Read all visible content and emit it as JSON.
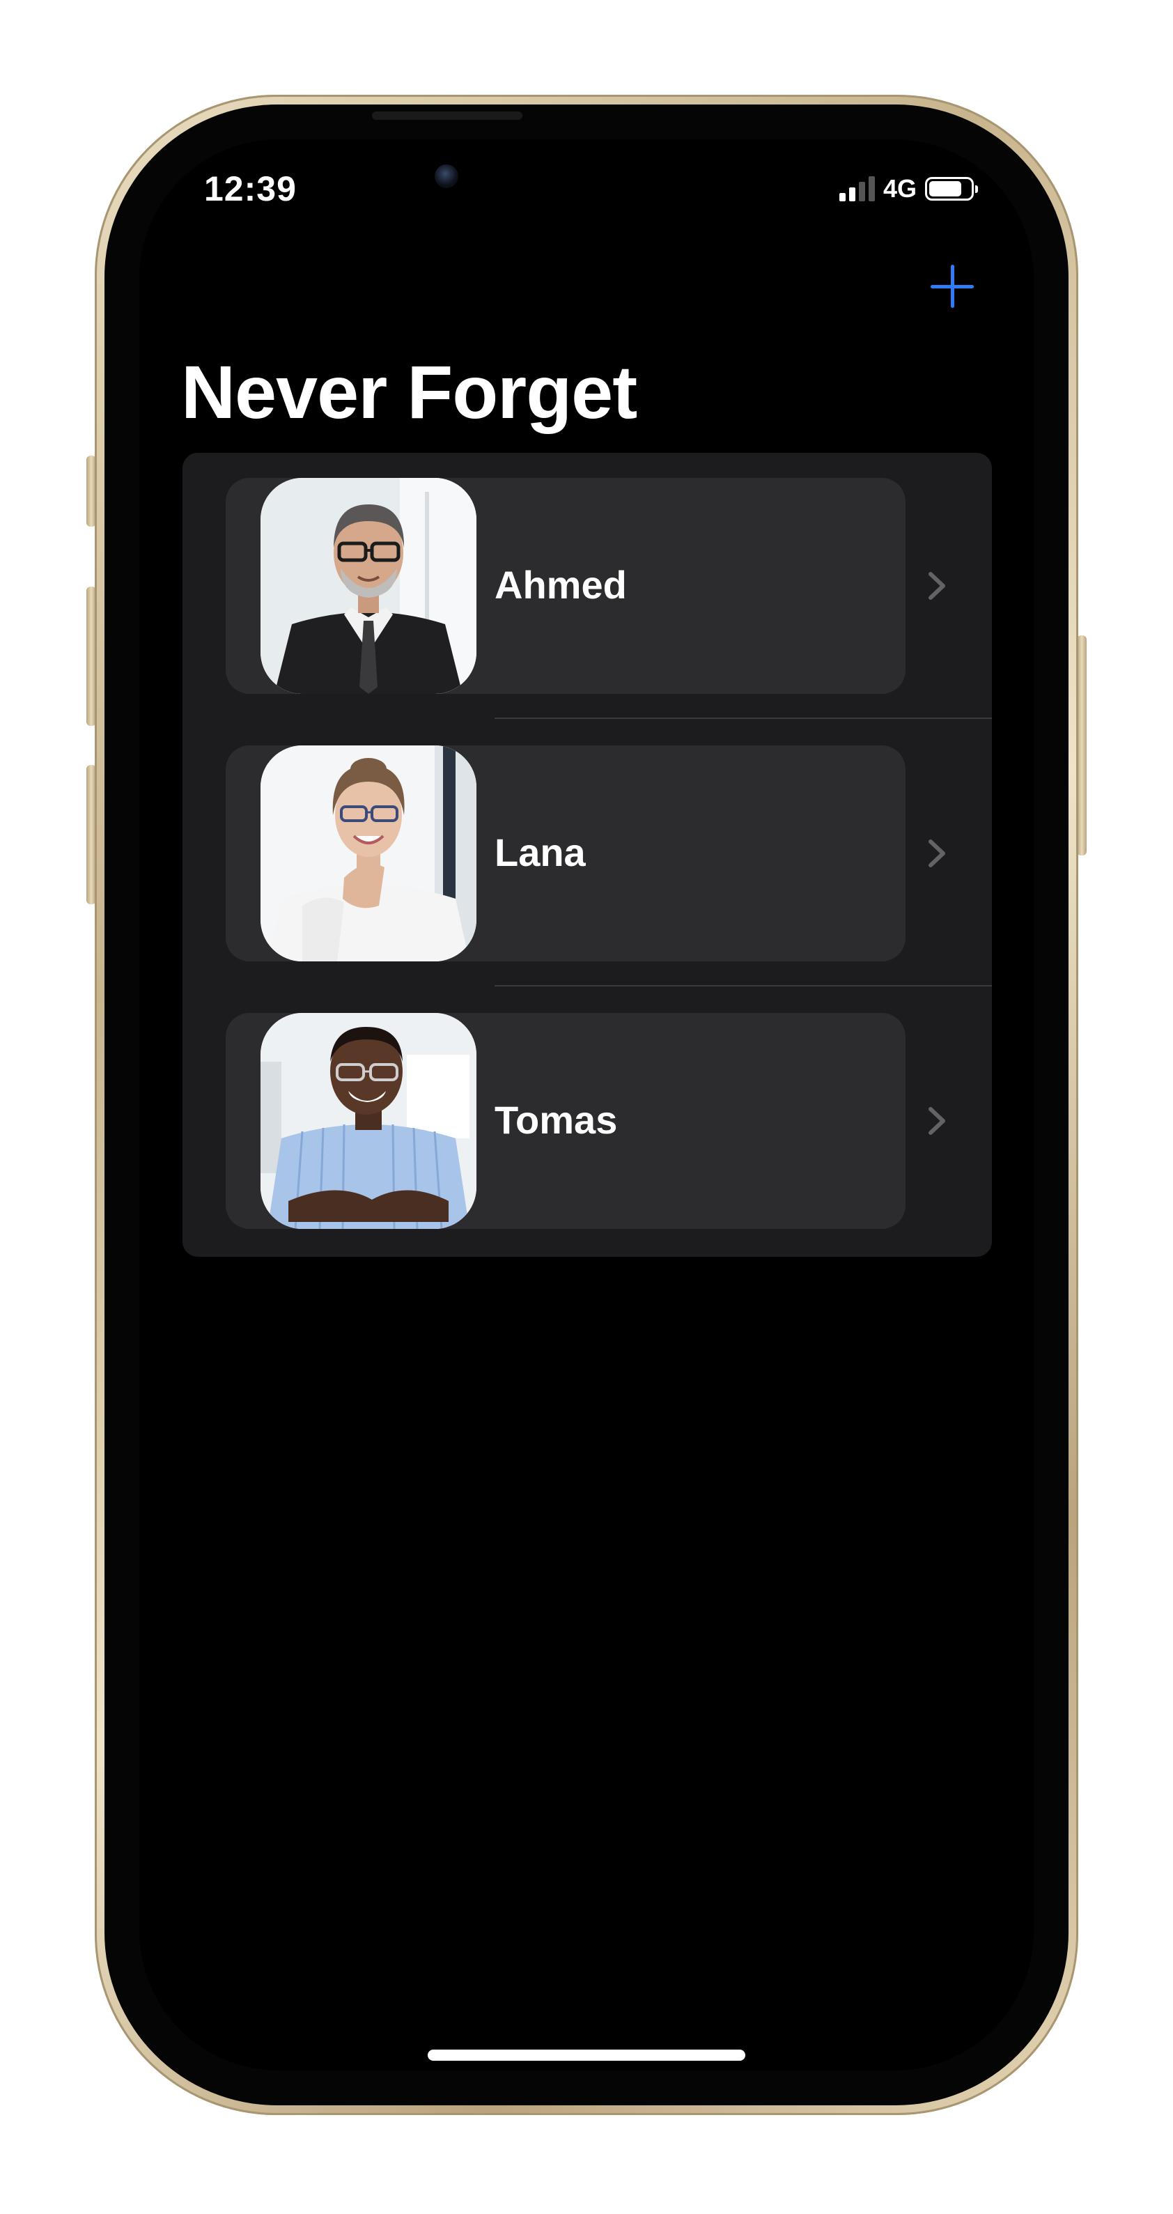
{
  "status_bar": {
    "time": "12:39",
    "network": "4G",
    "signal_bars": 4,
    "signal_bars_active": 2,
    "battery_level": 0.8
  },
  "nav": {
    "title": "Never Forget",
    "add_icon": "plus-icon",
    "accent_color": "#2f7cf6"
  },
  "people": [
    {
      "name": "Ahmed",
      "photo": "man-in-suit-with-glasses"
    },
    {
      "name": "Lana",
      "photo": "woman-in-white-blouse-with-glasses"
    },
    {
      "name": "Tomas",
      "photo": "man-in-striped-shirt-smiling"
    }
  ],
  "row_icon": "chevron-right-icon"
}
